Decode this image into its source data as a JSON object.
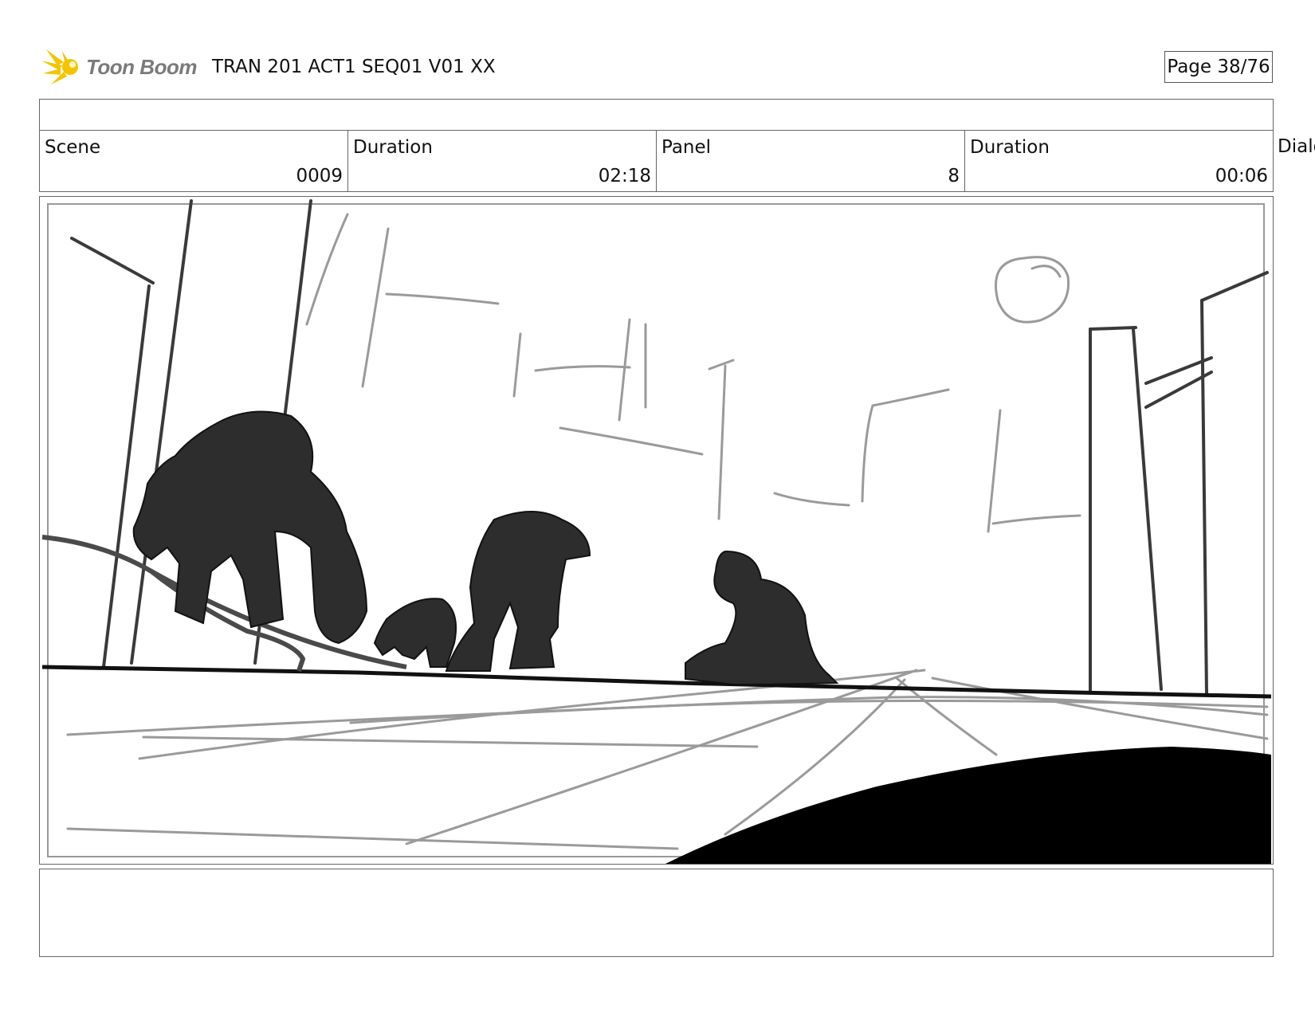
{
  "header": {
    "logo_text": "Toon Boom",
    "title": "TRAN 201 ACT1 SEQ01 V01 XX",
    "page": "Page 38/76"
  },
  "info": {
    "scene_label": "Scene",
    "scene_value": "0009",
    "scene_duration_label": "Duration",
    "scene_duration_value": "02:18",
    "panel_label": "Panel",
    "panel_value": "8",
    "panel_duration_label": "Duration",
    "panel_duration_value": "00:06",
    "dialog_label": "Dialog"
  },
  "colors": {
    "logo_star": "#f5c400",
    "logo_text": "#7a7a7a",
    "silhouette": "#2d2d2d",
    "sketch_gray": "#9a9a9a",
    "border": "#666666"
  }
}
